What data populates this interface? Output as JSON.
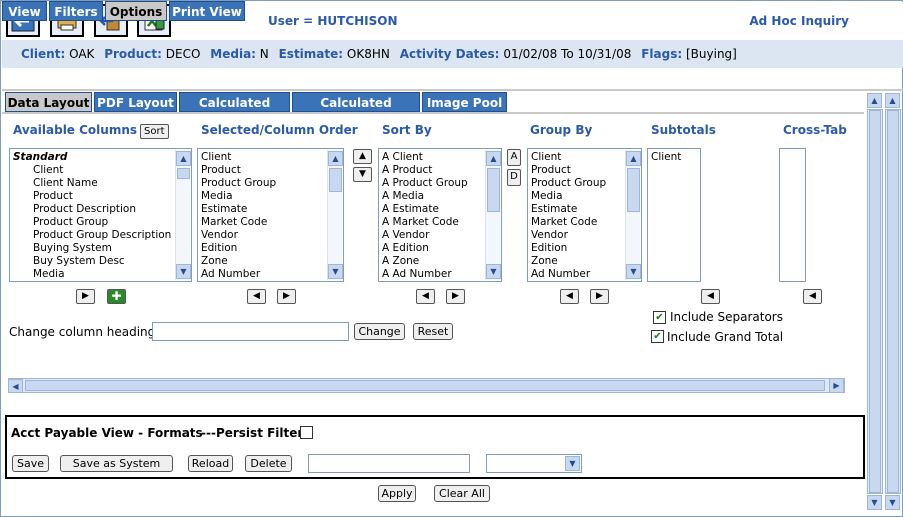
{
  "header": {
    "user": "User = HUTCHISON",
    "title": "Ad Hoc Inquiry"
  },
  "info": {
    "client_label": "Client:",
    "client": "OAK",
    "product_label": "Product:",
    "product": "DECO",
    "media_label": "Media:",
    "media": "N",
    "estimate_label": "Estimate:",
    "estimate": "OK8HN",
    "dates_label": "Activity Dates:",
    "dates": "01/02/08 To 10/31/08",
    "flags_label": "Flags:",
    "flags": "[Buying]"
  },
  "main_tabs": [
    "View",
    "Filters",
    "Options",
    "Print View"
  ],
  "sub_tabs": [
    "Data Layout",
    "PDF Layout",
    "Calculated Rows",
    "Calculated Columns",
    "Image Pool"
  ],
  "columns": {
    "available": {
      "title": "Available Columns",
      "sort_btn": "Sort",
      "items": [
        "Standard",
        "Client",
        "Client Name",
        "Product",
        "Product Description",
        "Product Group",
        "Product Group Description",
        "Buying System",
        "Buy System Desc",
        "Media"
      ]
    },
    "selected": {
      "title": "Selected/Column Order",
      "items": [
        "Client",
        "Product",
        "Product Group",
        "Media",
        "Estimate",
        "Market Code",
        "Vendor",
        "Edition",
        "Zone",
        "Ad Number"
      ]
    },
    "sortby": {
      "title": "Sort By",
      "asc": "A",
      "desc": "D",
      "items": [
        "A Client",
        "A Product",
        "A Product Group",
        "A Media",
        "A Estimate",
        "A Market Code",
        "A Vendor",
        "A Edition",
        "A Zone",
        "A Ad Number"
      ]
    },
    "groupby": {
      "title": "Group By",
      "items": [
        "Client",
        "Product",
        "Product Group",
        "Media",
        "Estimate",
        "Market Code",
        "Vendor",
        "Edition",
        "Zone",
        "Ad Number"
      ]
    },
    "subtotals": {
      "title": "Subtotals",
      "items": [
        "Client"
      ]
    },
    "crosstab": {
      "title": "Cross-Tab",
      "items": []
    }
  },
  "heading": {
    "label": "Change column heading:",
    "value": "",
    "change_btn": "Change",
    "reset_btn": "Reset"
  },
  "options": {
    "separators": "Include Separators",
    "grand_total": "Include Grand Total"
  },
  "formats": {
    "title": "Acct Payable View - Formats",
    "persist": "---Persist Filters",
    "save": "Save",
    "save_as": "Save as System",
    "reload": "Reload",
    "delete": "Delete",
    "name_value": "",
    "select_value": ""
  },
  "footer": {
    "apply": "Apply",
    "clear": "Clear All"
  },
  "colors": {
    "tab_blue": "#3b73b8",
    "header_blue": "#2a5aa8",
    "info_bg": "#dce6f2"
  }
}
